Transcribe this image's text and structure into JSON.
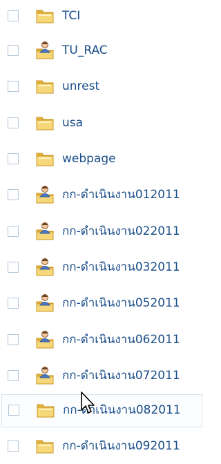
{
  "files": [
    {
      "name": "TCI",
      "icon": "folder-icon",
      "checked": false
    },
    {
      "name": "TU_RAC",
      "icon": "shared-folder-icon",
      "checked": false
    },
    {
      "name": "unrest",
      "icon": "folder-icon",
      "checked": false
    },
    {
      "name": "usa",
      "icon": "folder-icon",
      "checked": false
    },
    {
      "name": "webpage",
      "icon": "folder-icon",
      "checked": false
    },
    {
      "name": "กก-ดำเนินงาน012011",
      "icon": "shared-folder-icon",
      "checked": false
    },
    {
      "name": "กก-ดำเนินงาน022011",
      "icon": "shared-folder-icon",
      "checked": false
    },
    {
      "name": "กก-ดำเนินงาน032011",
      "icon": "shared-folder-icon",
      "checked": false
    },
    {
      "name": "กก-ดำเนินงาน052011",
      "icon": "shared-folder-icon",
      "checked": false
    },
    {
      "name": "กก-ดำเนินงาน062011",
      "icon": "shared-folder-icon",
      "checked": false
    },
    {
      "name": "กก-ดำเนินงาน072011",
      "icon": "shared-folder-icon",
      "checked": false
    },
    {
      "name": "กก-ดำเนินงาน082011",
      "icon": "folder-icon",
      "checked": false
    },
    {
      "name": "กก-ดำเนินงาน092011",
      "icon": "folder-icon",
      "checked": false
    }
  ],
  "hovered_row": 11,
  "cursor_icon": "mouse-pointer-icon",
  "colors": {
    "label": "#1a4e8a",
    "checkbox_border": "#b3c5d8",
    "folder": "#f3c95a",
    "hover_border": "#d6e3ee"
  }
}
